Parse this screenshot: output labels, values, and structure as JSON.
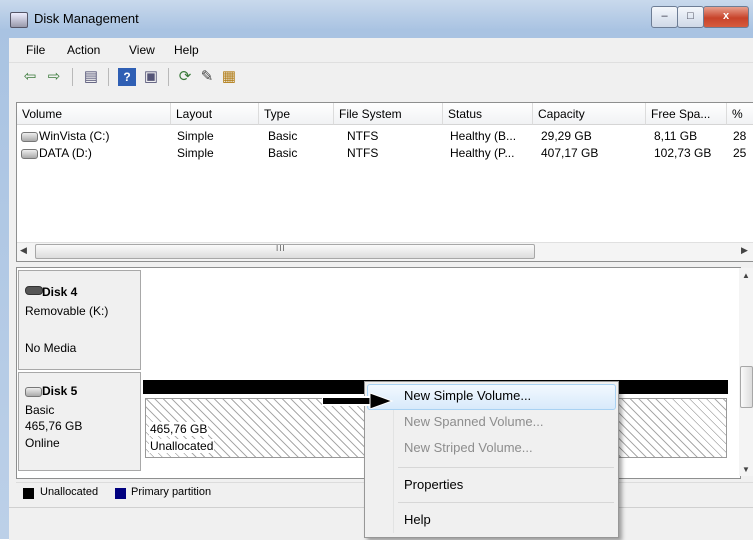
{
  "window": {
    "title": "Disk Management",
    "min": "–",
    "max": "□",
    "close": "x"
  },
  "menu": [
    "File",
    "Action",
    "View",
    "Help"
  ],
  "volume_list": {
    "columns": [
      "Volume",
      "Layout",
      "Type",
      "File System",
      "Status",
      "Capacity",
      "Free Spa...",
      "% F"
    ],
    "rows": [
      [
        "WinVista (C:)",
        "Simple",
        "Basic",
        "NTFS",
        "Healthy (B...",
        "29,29 GB",
        "8,11 GB",
        "28"
      ],
      [
        "DATA (D:)",
        "Simple",
        "Basic",
        "NTFS",
        "Healthy (P...",
        "407,17 GB",
        "102,73 GB",
        "25"
      ]
    ],
    "scroll_mark": "III"
  },
  "disks": [
    {
      "name": "Disk 4",
      "type": "Removable (K:)",
      "state": "No Media"
    },
    {
      "name": "Disk 5",
      "type": "Basic",
      "size": "465,76 GB",
      "state": "Online",
      "partition": {
        "size": "465,76 GB",
        "label": "Unallocated"
      }
    }
  ],
  "legend": {
    "unallocated": "Unallocated",
    "primary": "Primary partition",
    "unallocated_color": "#000000",
    "primary_color": "#00007f"
  },
  "context_menu": {
    "items": [
      "New Simple Volume...",
      "New Spanned Volume...",
      "New Striped Volume...",
      "Properties",
      "Help"
    ],
    "highlighted_index": 0,
    "disabled": [
      1,
      2
    ]
  }
}
